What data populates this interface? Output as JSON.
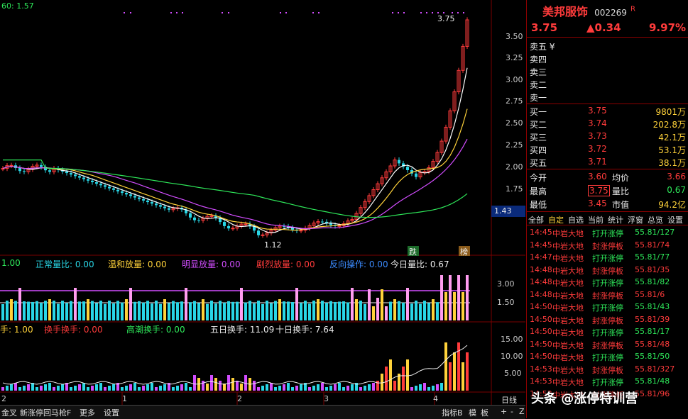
{
  "chart": {
    "top_left_label": "60: 1.57",
    "peak_label": "3.75",
    "low_label": "1.12",
    "last_price_tag": "1.43",
    "price_ticks": [
      "3.50",
      "3.25",
      "3.00",
      "2.75",
      "2.50",
      "2.25",
      "2.00",
      "1.75"
    ],
    "marker_die": "跌",
    "marker_bang": "榜",
    "indicator1": {
      "items": [
        {
          "label": "1.00",
          "color": "#2ee85a"
        },
        {
          "label": "正常量比: 0.00",
          "color": "#29d6e6"
        },
        {
          "label": "温和放量: 0.00",
          "color": "#ffd23a"
        },
        {
          "label": "明显放量: 0.00",
          "color": "#d24dff"
        },
        {
          "label": "剧烈放量: 0.00",
          "color": "#ff3b3b"
        },
        {
          "label": "反向操作: 0.00",
          "color": "#3b8bff"
        },
        {
          "label": "今日量比: 0.67",
          "color": "#eeeeee"
        }
      ],
      "ticks": [
        "3.00",
        "1.50"
      ]
    },
    "indicator2": {
      "items": [
        {
          "label": "手: 1.00",
          "color": "#ffd23a"
        },
        {
          "label": "换手换手: 0.00",
          "color": "#ff3b3b"
        },
        {
          "label": "高潮换手: 0.00",
          "color": "#2ee85a"
        },
        {
          "label": "五日换手: 11.09",
          "color": "#eeeeee"
        },
        {
          "label": "十日换手: 7.64",
          "color": "#eeeeee"
        }
      ],
      "ticks": [
        "15.00",
        "10.00",
        "5.00"
      ]
    },
    "x_ticks": [
      "1",
      "2",
      "3",
      "4"
    ],
    "bottom_bar": [
      "金叉",
      "新涨停回马枪F",
      "更多",
      "设置",
      "指标B",
      "模",
      "板",
      "日线",
      "+",
      "-",
      "Z"
    ]
  },
  "quote": {
    "name": "美邦服饰",
    "code": "002269",
    "flag": "R",
    "price": "3.75",
    "change": "▲0.34",
    "pct": "9.97%",
    "asks": [
      {
        "label": "卖五 ¥",
        "price": "",
        "vol": ""
      },
      {
        "label": "卖四",
        "price": "",
        "vol": ""
      },
      {
        "label": "卖三",
        "price": "",
        "vol": ""
      },
      {
        "label": "卖二",
        "price": "",
        "vol": ""
      },
      {
        "label": "卖一",
        "price": "",
        "vol": ""
      }
    ],
    "bids": [
      {
        "label": "买一",
        "price": "3.75",
        "vol": "9801万"
      },
      {
        "label": "买二",
        "price": "3.74",
        "vol": "202.8万"
      },
      {
        "label": "买三",
        "price": "3.73",
        "vol": "42.1万"
      },
      {
        "label": "买四",
        "price": "3.72",
        "vol": "53.1万"
      },
      {
        "label": "买五",
        "price": "3.71",
        "vol": "38.1万"
      }
    ],
    "stats": [
      {
        "l1": "今开",
        "v1": "3.60",
        "l2": "均价",
        "v2": "3.66"
      },
      {
        "l1": "最高",
        "v1": "3.75",
        "l2": "量比",
        "v2": "0.67"
      },
      {
        "l1": "最低",
        "v1": "3.45",
        "l2": "市值",
        "v2": "94.2亿"
      }
    ],
    "tabs": [
      "全部",
      "自定",
      "自选",
      "当前",
      "统计",
      "浮窗",
      "总览",
      "设置"
    ],
    "ticks": [
      {
        "time": "14:45",
        "who": "中岩大地",
        "act": "打开涨停",
        "val": "55.81/127"
      },
      {
        "time": "14:45",
        "who": "中岩大地",
        "act": "封涨停板",
        "val": "55.81/74"
      },
      {
        "time": "14:47",
        "who": "中岩大地",
        "act": "打开涨停",
        "val": "55.81/77"
      },
      {
        "time": "14:48",
        "who": "中岩大地",
        "act": "封涨停板",
        "val": "55.81/35"
      },
      {
        "time": "14:48",
        "who": "中岩大地",
        "act": "打开涨停",
        "val": "55.81/82"
      },
      {
        "time": "14:48",
        "who": "中岩大地",
        "act": "封涨停板",
        "val": "55.81/6"
      },
      {
        "time": "14:50",
        "who": "中岩大地",
        "act": "打开涨停",
        "val": "55.81/43"
      },
      {
        "time": "14:50",
        "who": "中岩大地",
        "act": "封涨停板",
        "val": "55.81/39"
      },
      {
        "time": "14:50",
        "who": "中岩大地",
        "act": "打开涨停",
        "val": "55.81/17"
      },
      {
        "time": "14:50",
        "who": "中岩大地",
        "act": "封涨停板",
        "val": "55.81/48"
      },
      {
        "time": "14:50",
        "who": "中岩大地",
        "act": "打开涨停",
        "val": "55.81/50"
      },
      {
        "time": "14:53",
        "who": "中岩大地",
        "act": "封涨停板",
        "val": "55.81/327"
      },
      {
        "time": "14:53",
        "who": "中岩大地",
        "act": "打开涨停",
        "val": "55.81/48"
      },
      {
        "time": "14:53",
        "who": "中岩大地",
        "act": "封涨停板",
        "val": "55.81/96"
      }
    ]
  },
  "watermark": "头条 @涨停特训营"
}
